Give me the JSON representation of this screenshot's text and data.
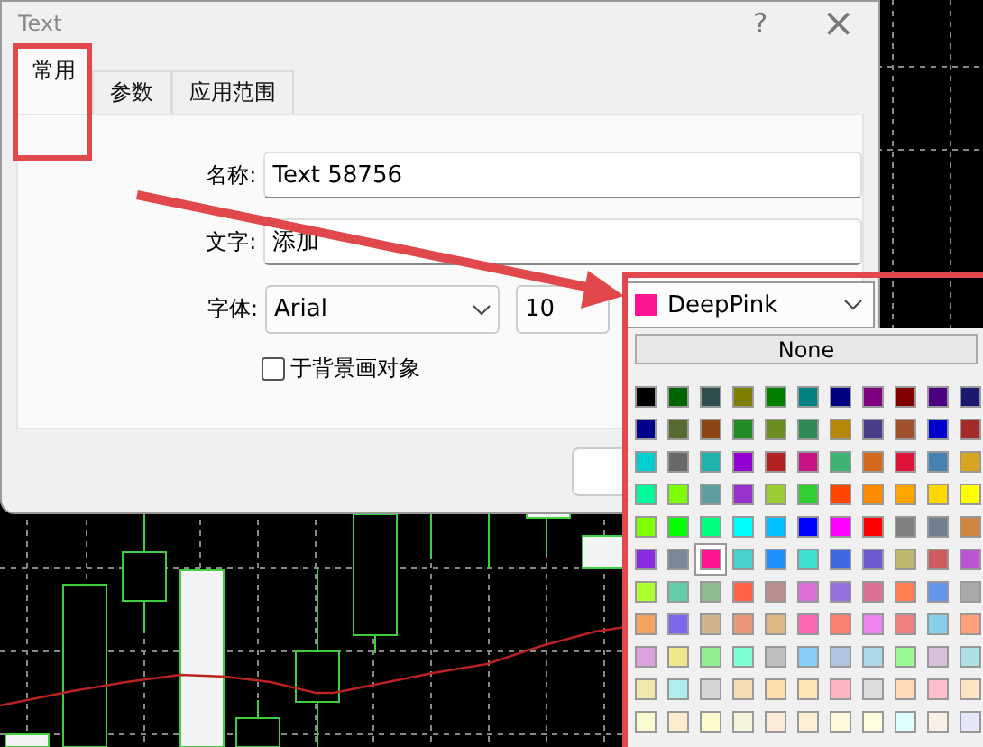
{
  "window": {
    "title": "Text",
    "help_button": "?",
    "close_button": "×"
  },
  "tabs": [
    {
      "label": "常用",
      "selected": true
    },
    {
      "label": "参数",
      "selected": false
    },
    {
      "label": "应用范围",
      "selected": false
    }
  ],
  "fields": [
    {
      "label": "名称:",
      "value": "Text 58756"
    },
    {
      "label": "文字:",
      "value": "添加"
    }
  ],
  "font": {
    "label": "字体:",
    "family": "Arial",
    "size": "10",
    "color_name": "DeepPink",
    "color": "#ff1493"
  },
  "background_checkbox": {
    "label": "于背景画对象",
    "checked": false
  },
  "color_popup": {
    "none_button": "None",
    "swatches": [
      {
        "color": "#000000",
        "selected": false
      },
      {
        "color": "#006400",
        "selected": false
      },
      {
        "color": "#2f4f4f",
        "selected": false
      },
      {
        "color": "#808000",
        "selected": false
      },
      {
        "color": "#008000",
        "selected": false
      },
      {
        "color": "#008080",
        "selected": false
      },
      {
        "color": "#000080",
        "selected": false
      },
      {
        "color": "#800080",
        "selected": false
      },
      {
        "color": "#800000",
        "selected": false
      },
      {
        "color": "#4b0082",
        "selected": false
      },
      {
        "color": "#191970",
        "selected": false
      },
      {
        "color": "#00008b",
        "selected": false
      },
      {
        "color": "#556b2f",
        "selected": false
      },
      {
        "color": "#8b4513",
        "selected": false
      },
      {
        "color": "#228b22",
        "selected": false
      },
      {
        "color": "#6b8e23",
        "selected": false
      },
      {
        "color": "#2e8b57",
        "selected": false
      },
      {
        "color": "#b8860b",
        "selected": false
      },
      {
        "color": "#483d8b",
        "selected": false
      },
      {
        "color": "#a0522d",
        "selected": false
      },
      {
        "color": "#0000cd",
        "selected": false
      },
      {
        "color": "#a52a2a",
        "selected": false
      },
      {
        "color": "#00ced1",
        "selected": false
      },
      {
        "color": "#696969",
        "selected": false
      },
      {
        "color": "#20b2aa",
        "selected": false
      },
      {
        "color": "#9400d3",
        "selected": false
      },
      {
        "color": "#b22222",
        "selected": false
      },
      {
        "color": "#c71585",
        "selected": false
      },
      {
        "color": "#3cb371",
        "selected": false
      },
      {
        "color": "#d2691e",
        "selected": false
      },
      {
        "color": "#dc143c",
        "selected": false
      },
      {
        "color": "#4682b4",
        "selected": false
      },
      {
        "color": "#daa520",
        "selected": false
      },
      {
        "color": "#00fa9a",
        "selected": false
      },
      {
        "color": "#7cfc00",
        "selected": false
      },
      {
        "color": "#5f9ea0",
        "selected": false
      },
      {
        "color": "#9932cc",
        "selected": false
      },
      {
        "color": "#9acd32",
        "selected": false
      },
      {
        "color": "#32cd32",
        "selected": false
      },
      {
        "color": "#ff4500",
        "selected": false
      },
      {
        "color": "#ff8c00",
        "selected": false
      },
      {
        "color": "#ffa500",
        "selected": false
      },
      {
        "color": "#ffd700",
        "selected": false
      },
      {
        "color": "#ffff00",
        "selected": false
      },
      {
        "color": "#7fff00",
        "selected": false
      },
      {
        "color": "#00ff00",
        "selected": false
      },
      {
        "color": "#00ff7f",
        "selected": false
      },
      {
        "color": "#00ffff",
        "selected": false
      },
      {
        "color": "#00bfff",
        "selected": false
      },
      {
        "color": "#0000ff",
        "selected": false
      },
      {
        "color": "#ff00ff",
        "selected": false
      },
      {
        "color": "#ff0000",
        "selected": false
      },
      {
        "color": "#808080",
        "selected": false
      },
      {
        "color": "#708090",
        "selected": false
      },
      {
        "color": "#cd853f",
        "selected": false
      },
      {
        "color": "#8a2be2",
        "selected": false
      },
      {
        "color": "#778899",
        "selected": false
      },
      {
        "color": "#ff1493",
        "selected": true
      },
      {
        "color": "#48d1cc",
        "selected": false
      },
      {
        "color": "#1e90ff",
        "selected": false
      },
      {
        "color": "#40e0d0",
        "selected": false
      },
      {
        "color": "#4169e1",
        "selected": false
      },
      {
        "color": "#6a5acd",
        "selected": false
      },
      {
        "color": "#bdb76b",
        "selected": false
      },
      {
        "color": "#cd5c5c",
        "selected": false
      },
      {
        "color": "#ba55d3",
        "selected": false
      },
      {
        "color": "#adff2f",
        "selected": false
      },
      {
        "color": "#66cdaa",
        "selected": false
      },
      {
        "color": "#8fbc8f",
        "selected": false
      },
      {
        "color": "#ff6347",
        "selected": false
      },
      {
        "color": "#bc8f8f",
        "selected": false
      },
      {
        "color": "#da70d6",
        "selected": false
      },
      {
        "color": "#9370db",
        "selected": false
      },
      {
        "color": "#db7093",
        "selected": false
      },
      {
        "color": "#ff7f50",
        "selected": false
      },
      {
        "color": "#6495ed",
        "selected": false
      },
      {
        "color": "#a9a9a9",
        "selected": false
      },
      {
        "color": "#f4a460",
        "selected": false
      },
      {
        "color": "#7b68ee",
        "selected": false
      },
      {
        "color": "#d2b48c",
        "selected": false
      },
      {
        "color": "#e9967a",
        "selected": false
      },
      {
        "color": "#deb887",
        "selected": false
      },
      {
        "color": "#ff69b4",
        "selected": false
      },
      {
        "color": "#fa8072",
        "selected": false
      },
      {
        "color": "#ee82ee",
        "selected": false
      },
      {
        "color": "#f08080",
        "selected": false
      },
      {
        "color": "#87ceeb",
        "selected": false
      },
      {
        "color": "#ffa07a",
        "selected": false
      },
      {
        "color": "#dda0dd",
        "selected": false
      },
      {
        "color": "#f0e68c",
        "selected": false
      },
      {
        "color": "#90ee90",
        "selected": false
      },
      {
        "color": "#7fffd4",
        "selected": false
      },
      {
        "color": "#c0c0c0",
        "selected": false
      },
      {
        "color": "#87cefa",
        "selected": false
      },
      {
        "color": "#b0c4de",
        "selected": false
      },
      {
        "color": "#add8e6",
        "selected": false
      },
      {
        "color": "#98fb98",
        "selected": false
      },
      {
        "color": "#d8bfd8",
        "selected": false
      },
      {
        "color": "#b0e0e6",
        "selected": false
      },
      {
        "color": "#eee8aa",
        "selected": false
      },
      {
        "color": "#afeeee",
        "selected": false
      },
      {
        "color": "#d3d3d3",
        "selected": false
      },
      {
        "color": "#f5deb3",
        "selected": false
      },
      {
        "color": "#ffdead",
        "selected": false
      },
      {
        "color": "#ffe4b5",
        "selected": false
      },
      {
        "color": "#ffb6c1",
        "selected": false
      },
      {
        "color": "#dcdcdc",
        "selected": false
      },
      {
        "color": "#ffdab9",
        "selected": false
      },
      {
        "color": "#ffc0cb",
        "selected": false
      },
      {
        "color": "#ffe4c4",
        "selected": false
      },
      {
        "color": "#fafad2",
        "selected": false
      },
      {
        "color": "#ffebcd",
        "selected": false
      },
      {
        "color": "#fffacd",
        "selected": false
      },
      {
        "color": "#f5f5dc",
        "selected": false
      },
      {
        "color": "#faebd7",
        "selected": false
      },
      {
        "color": "#ffefd5",
        "selected": false
      },
      {
        "color": "#fff8dc",
        "selected": false
      },
      {
        "color": "#ffffe0",
        "selected": false
      },
      {
        "color": "#e0ffff",
        "selected": false
      },
      {
        "color": "#faf0e6",
        "selected": false
      },
      {
        "color": "#e6e6fa",
        "selected": false
      }
    ]
  }
}
